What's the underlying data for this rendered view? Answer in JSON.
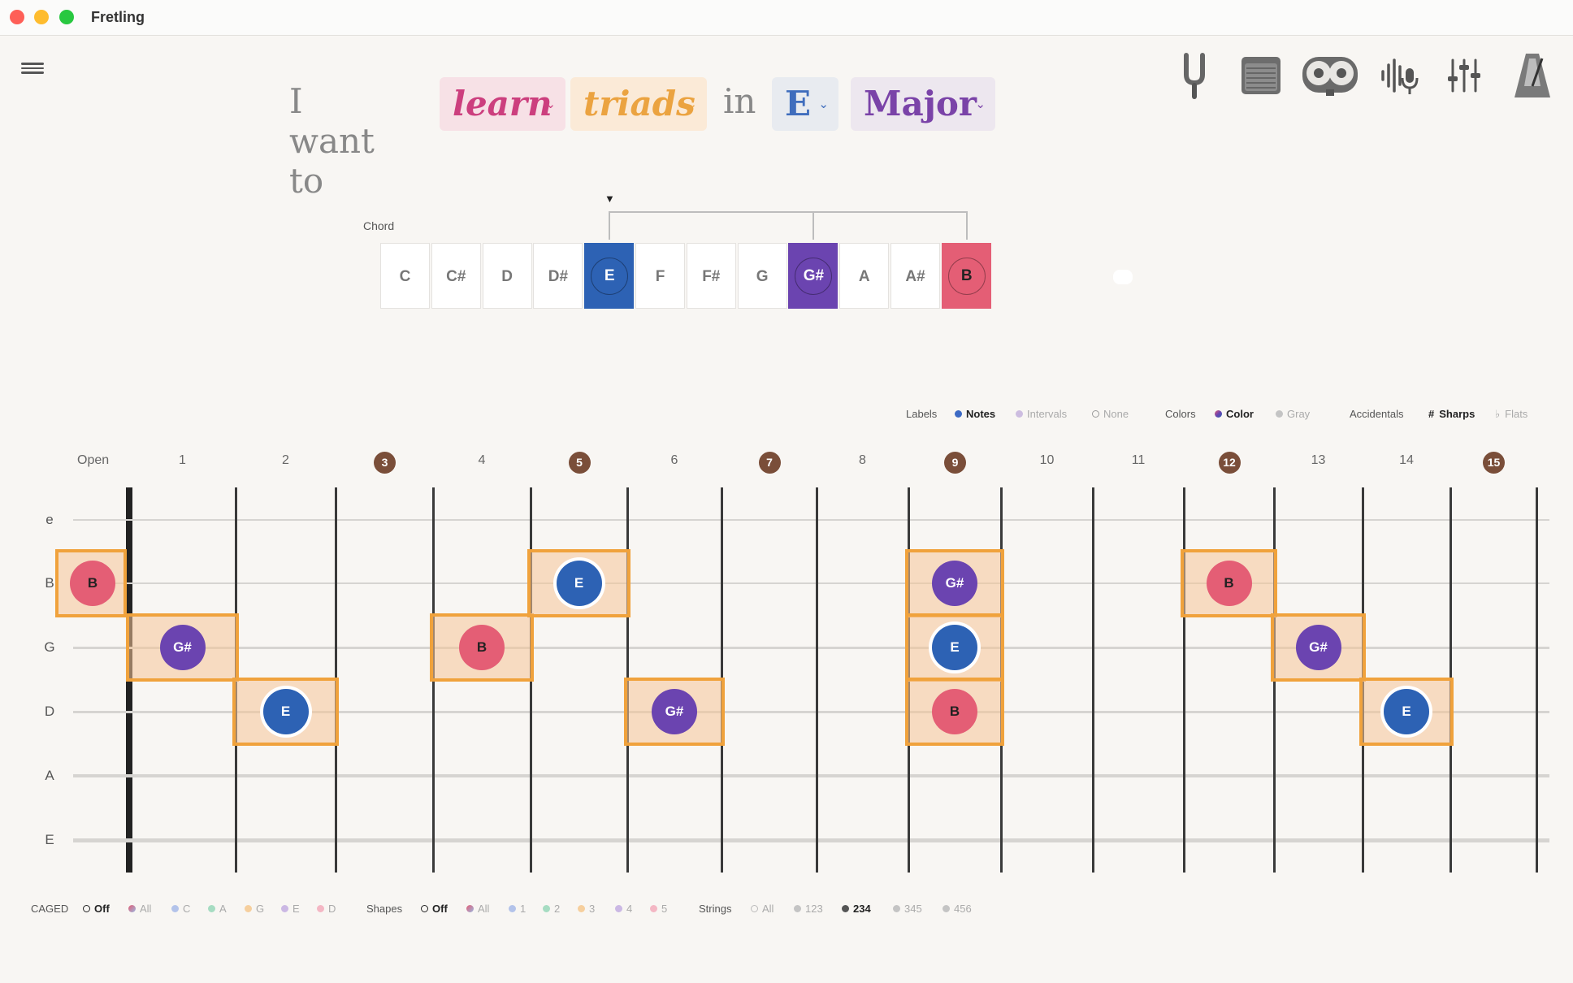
{
  "app": {
    "title": "Fretling"
  },
  "sentence": {
    "prefix": "I want to",
    "mode": "learn",
    "topic": "triads",
    "connector": "in",
    "key": "E",
    "scale": "Major",
    "colors": {
      "mode": "#cc3f7e",
      "mode_bg": "#f7e1e6",
      "topic": "#eba340",
      "topic_bg": "#fbead7",
      "key": "#3f6dbd",
      "key_bg": "#e8ebf0",
      "scale": "#7a43a8",
      "scale_bg": "#ede7ef"
    }
  },
  "toolbar": {
    "icons": [
      "tuning-fork-icon",
      "amplifier-icon",
      "tape-recorder-icon",
      "audio-mic-icon",
      "mixer-sliders-icon",
      "metronome-icon"
    ]
  },
  "chord": {
    "label": "Chord",
    "marker": "▼",
    "notes": [
      "C",
      "C#",
      "D",
      "D#",
      "E",
      "F",
      "F#",
      "G",
      "G#",
      "A",
      "A#",
      "B"
    ]
  },
  "display_options": {
    "labels": {
      "title": "Labels",
      "options": [
        "Notes",
        "Intervals",
        "None"
      ],
      "selected": "Notes"
    },
    "colors": {
      "title": "Colors",
      "options": [
        "Color",
        "Gray"
      ],
      "selected": "Color"
    },
    "accidentals": {
      "title": "Accidentals",
      "options": [
        "Sharps",
        "Flats"
      ],
      "selected": "Sharps",
      "sharp_symbol": "#",
      "flat_symbol": "♭"
    }
  },
  "fretboard": {
    "open_label": "Open",
    "fret_numbers": [
      "1",
      "2",
      "3",
      "4",
      "5",
      "6",
      "7",
      "8",
      "9",
      "10",
      "11",
      "12",
      "13",
      "14",
      "15"
    ],
    "marked_frets": [
      "3",
      "5",
      "7",
      "9",
      "12",
      "15"
    ],
    "strings": [
      "e",
      "B",
      "G",
      "D",
      "A",
      "E"
    ],
    "note_colors": {
      "E": "#2d62b4",
      "G#": "#6b44b0",
      "B": "#e45e75"
    },
    "highlight_color": "#f0a23c",
    "notes": [
      {
        "string": "B",
        "fret": "Open",
        "label": "B"
      },
      {
        "string": "G",
        "fret": "1",
        "label": "G#"
      },
      {
        "string": "D",
        "fret": "2",
        "label": "E"
      },
      {
        "string": "G",
        "fret": "4",
        "label": "B"
      },
      {
        "string": "B",
        "fret": "5",
        "label": "E"
      },
      {
        "string": "D",
        "fret": "6",
        "label": "G#"
      },
      {
        "string": "B",
        "fret": "9",
        "label": "G#"
      },
      {
        "string": "G",
        "fret": "9",
        "label": "E"
      },
      {
        "string": "D",
        "fret": "9",
        "label": "B"
      },
      {
        "string": "B",
        "fret": "12",
        "label": "B"
      },
      {
        "string": "G",
        "fret": "13",
        "label": "G#"
      },
      {
        "string": "D",
        "fret": "14",
        "label": "E"
      }
    ]
  },
  "bottom_options": {
    "caged": {
      "title": "CAGED",
      "options": [
        "Off",
        "All",
        "C",
        "A",
        "G",
        "E",
        "D"
      ],
      "selected": "Off"
    },
    "shapes": {
      "title": "Shapes",
      "options": [
        "Off",
        "All",
        "1",
        "2",
        "3",
        "4",
        "5"
      ],
      "selected": "Off"
    },
    "strings": {
      "title": "Strings",
      "options": [
        "All",
        "123",
        "234",
        "345",
        "456"
      ],
      "selected": "234"
    }
  }
}
